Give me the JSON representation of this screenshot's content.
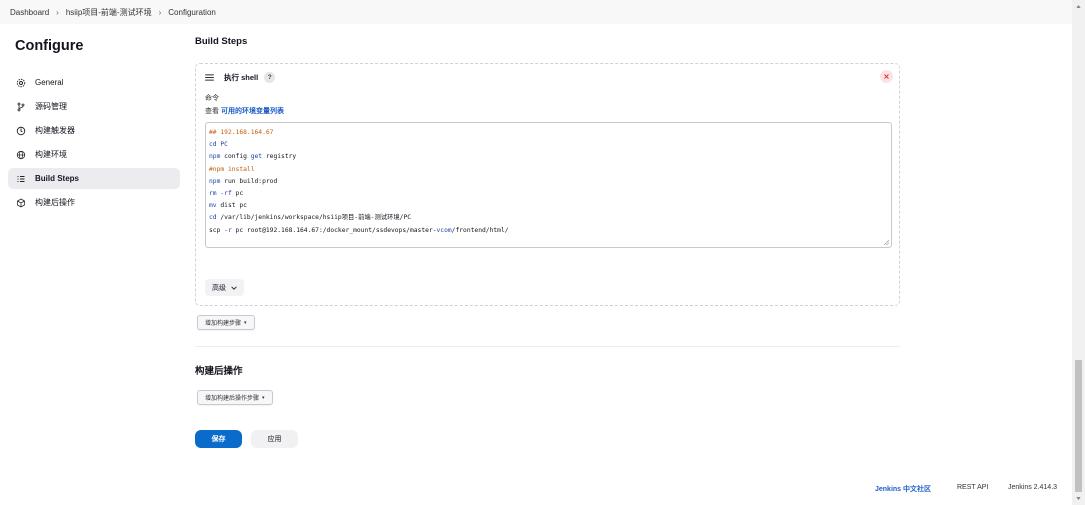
{
  "breadcrumb": [
    "Dashboard",
    "hsiip项目-前端-测试环境",
    "Configuration"
  ],
  "sidebar": {
    "title": "Configure",
    "items": [
      {
        "label": "General",
        "icon": "gear-icon"
      },
      {
        "label": "源码管理",
        "icon": "branch-icon"
      },
      {
        "label": "构建触发器",
        "icon": "clock-icon"
      },
      {
        "label": "构建环境",
        "icon": "globe-icon"
      },
      {
        "label": "Build Steps",
        "icon": "list-icon",
        "active": true
      },
      {
        "label": "构建后操作",
        "icon": "cube-icon"
      }
    ]
  },
  "build_steps": {
    "title": "Build Steps",
    "step": {
      "title": "执行 shell",
      "help": "?",
      "command_label": "命令",
      "env_prefix": "查看",
      "env_link": "可用的环境变量列表",
      "code": [
        "## 192.168.164.67",
        "cd PC",
        "npm config get registry",
        "#npm install",
        "npm run build:prod",
        "rm -rf pc",
        "mv dist pc",
        "cd /var/lib/jenkins/workspace/hsiip项目-前端-测试环境/PC",
        "scp -r pc root@192.168.164.67:/docker_mount/ssdevops/master-vcom/frontend/html/"
      ],
      "advanced_label": "高级"
    },
    "add_step_label": "增加构建步骤"
  },
  "post_build": {
    "title": "构建后操作",
    "add_label": "增加构建后操作步骤"
  },
  "buttons": {
    "save": "保存",
    "apply": "应用"
  },
  "footer": {
    "community": "Jenkins 中文社区",
    "rest_api": "REST API",
    "version": "Jenkins 2.414.3"
  }
}
